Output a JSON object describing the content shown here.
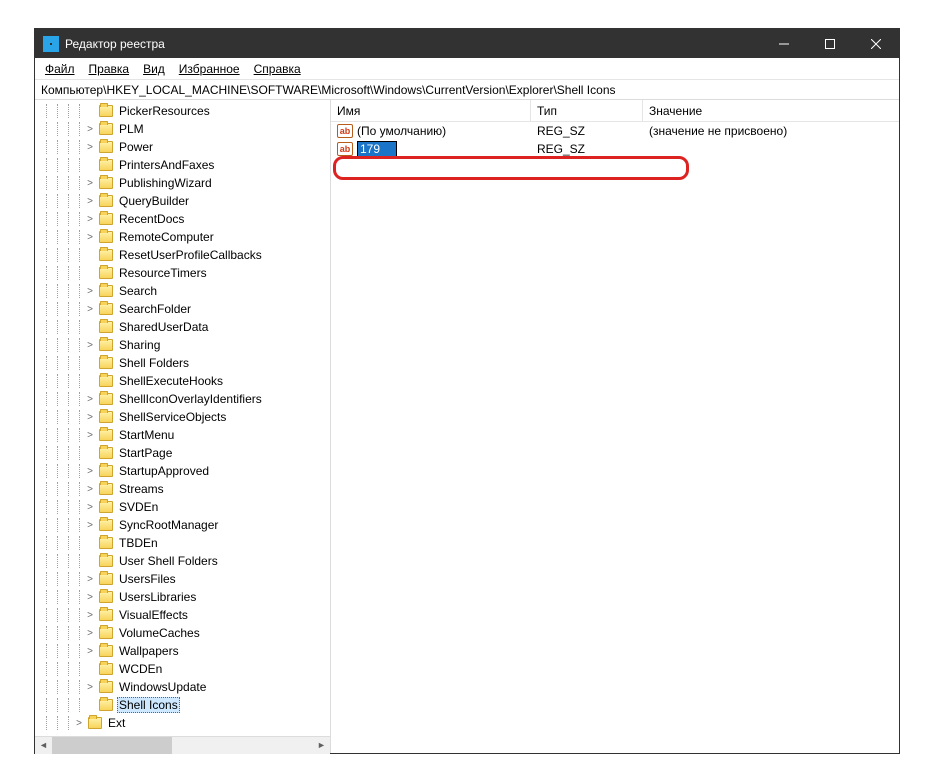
{
  "titlebar": {
    "title": "Редактор реестра"
  },
  "menu": {
    "file": "Файл",
    "edit": "Правка",
    "view": "Вид",
    "favorites": "Избранное",
    "help": "Справка"
  },
  "address": "Компьютер\\HKEY_LOCAL_MACHINE\\SOFTWARE\\Microsoft\\Windows\\CurrentVersion\\Explorer\\Shell Icons",
  "tree": [
    {
      "name": "PickerResources",
      "depth": 4,
      "expand": "none"
    },
    {
      "name": "PLM",
      "depth": 4,
      "expand": "closed"
    },
    {
      "name": "Power",
      "depth": 4,
      "expand": "closed"
    },
    {
      "name": "PrintersAndFaxes",
      "depth": 4,
      "expand": "none"
    },
    {
      "name": "PublishingWizard",
      "depth": 4,
      "expand": "closed"
    },
    {
      "name": "QueryBuilder",
      "depth": 4,
      "expand": "closed"
    },
    {
      "name": "RecentDocs",
      "depth": 4,
      "expand": "closed"
    },
    {
      "name": "RemoteComputer",
      "depth": 4,
      "expand": "closed"
    },
    {
      "name": "ResetUserProfileCallbacks",
      "depth": 4,
      "expand": "none"
    },
    {
      "name": "ResourceTimers",
      "depth": 4,
      "expand": "none"
    },
    {
      "name": "Search",
      "depth": 4,
      "expand": "closed"
    },
    {
      "name": "SearchFolder",
      "depth": 4,
      "expand": "closed"
    },
    {
      "name": "SharedUserData",
      "depth": 4,
      "expand": "none"
    },
    {
      "name": "Sharing",
      "depth": 4,
      "expand": "closed"
    },
    {
      "name": "Shell Folders",
      "depth": 4,
      "expand": "none"
    },
    {
      "name": "ShellExecuteHooks",
      "depth": 4,
      "expand": "none"
    },
    {
      "name": "ShellIconOverlayIdentifiers",
      "depth": 4,
      "expand": "closed"
    },
    {
      "name": "ShellServiceObjects",
      "depth": 4,
      "expand": "closed"
    },
    {
      "name": "StartMenu",
      "depth": 4,
      "expand": "closed"
    },
    {
      "name": "StartPage",
      "depth": 4,
      "expand": "none"
    },
    {
      "name": "StartupApproved",
      "depth": 4,
      "expand": "closed"
    },
    {
      "name": "Streams",
      "depth": 4,
      "expand": "closed"
    },
    {
      "name": "SVDEn",
      "depth": 4,
      "expand": "closed"
    },
    {
      "name": "SyncRootManager",
      "depth": 4,
      "expand": "closed"
    },
    {
      "name": "TBDEn",
      "depth": 4,
      "expand": "none"
    },
    {
      "name": "User Shell Folders",
      "depth": 4,
      "expand": "none"
    },
    {
      "name": "UsersFiles",
      "depth": 4,
      "expand": "closed"
    },
    {
      "name": "UsersLibraries",
      "depth": 4,
      "expand": "closed"
    },
    {
      "name": "VisualEffects",
      "depth": 4,
      "expand": "closed"
    },
    {
      "name": "VolumeCaches",
      "depth": 4,
      "expand": "closed"
    },
    {
      "name": "Wallpapers",
      "depth": 4,
      "expand": "closed"
    },
    {
      "name": "WCDEn",
      "depth": 4,
      "expand": "none"
    },
    {
      "name": "WindowsUpdate",
      "depth": 4,
      "expand": "closed"
    },
    {
      "name": "Shell Icons",
      "depth": 4,
      "expand": "none",
      "selected": true
    },
    {
      "name": "Ext",
      "depth": 3,
      "expand": "closed"
    }
  ],
  "columns": {
    "name": "Имя",
    "type": "Тип",
    "value": "Значение"
  },
  "rows": [
    {
      "name": "(По умолчанию)",
      "type": "REG_SZ",
      "value": "(значение не присвоено)",
      "editing": false
    },
    {
      "name": "179",
      "type": "REG_SZ",
      "value": "",
      "editing": true
    }
  ],
  "icons": {
    "string_label": "ab"
  },
  "scroll": {
    "left": "◄",
    "right": "►"
  }
}
